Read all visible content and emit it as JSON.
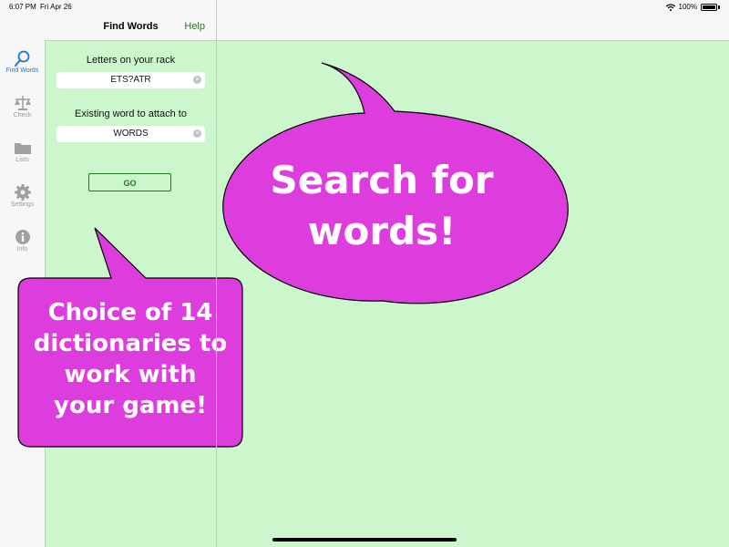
{
  "status": {
    "time": "6:07 PM",
    "date": "Fri Apr 26",
    "battery": "100%"
  },
  "nav": {
    "title": "Find Words",
    "help": "Help"
  },
  "tabs": [
    {
      "label": "Find Words",
      "icon": "search-icon",
      "active": true
    },
    {
      "label": "Check",
      "icon": "scale-icon"
    },
    {
      "label": "Lists",
      "icon": "folder-icon"
    },
    {
      "label": "Settings",
      "icon": "gear-icon"
    },
    {
      "label": "Info",
      "icon": "info-icon"
    }
  ],
  "form": {
    "rack_label": "Letters on your rack",
    "rack_value": "ETS?ATR",
    "attach_label": "Existing word to attach to",
    "attach_value": "WORDS",
    "go_label": "GO"
  },
  "callouts": {
    "big": "Search for words!",
    "big_line1": "Search for",
    "big_line2": "words!",
    "small_line1": "Choice of 14",
    "small_line2": "dictionaries to",
    "small_line3": "work with",
    "small_line4": "your game!"
  },
  "colors": {
    "accent": "#1f7a1f",
    "background": "#ccf7cc",
    "bubble": "#dd3ddd",
    "tab_active": "#1a73d9"
  }
}
